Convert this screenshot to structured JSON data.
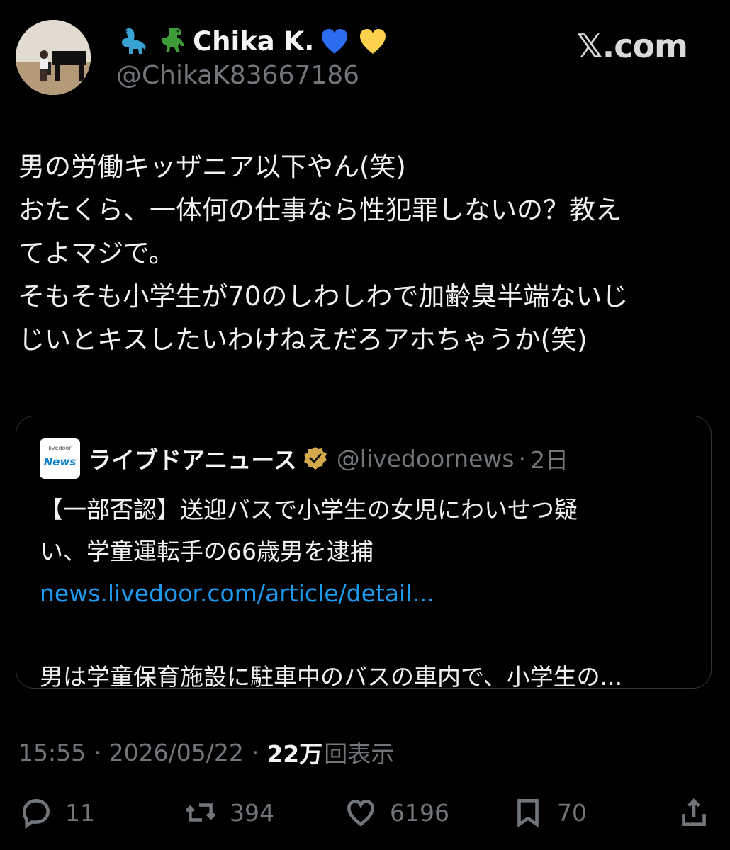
{
  "header": {
    "name": "Chika K.",
    "handle": "@ChikaK83667186",
    "emoji": [
      "sauropod-icon",
      "t-rex-icon",
      "blue-heart-icon",
      "yellow-heart-icon"
    ],
    "site": "𝕏.com"
  },
  "tweet": {
    "lines": [
      "男の労働キッザニア以下やん(笑)",
      "おたくら、一体何の仕事なら性犯罪しないの？教え",
      "てよマジで。",
      "そもそも小学生が70のしわしわで加齢臭半端ないじ",
      "じいとキスしたいわけねえだろアホちゃうか(笑)"
    ]
  },
  "quote": {
    "logo_top": "livedoor",
    "logo_bottom": "News",
    "name": "ライブドアニュース",
    "handle": "@livedoornews",
    "separator": "·",
    "time": "2日",
    "lines": [
      "【一部否認】送迎バスで小学生の女児にわいせつ疑",
      "い、学童運転手の66歳男を逮捕"
    ],
    "link": "news.livedoor.com/article/detail...",
    "summary": "男は学童保育施設に駐車中のバスの車内で、小学生の..."
  },
  "meta": {
    "time": "15:55",
    "separator": "·",
    "date": "2026/05/22",
    "views_number": "22万",
    "views_label": "回表示"
  },
  "actions": {
    "replies": "11",
    "reposts": "394",
    "likes": "6196",
    "bookmarks": "70"
  },
  "colors": {
    "background": "#000000",
    "text": "#e7e9ea",
    "muted": "#71767b",
    "link": "#1d9bf0",
    "border": "#2f3336",
    "verified": "#d4a94b"
  }
}
